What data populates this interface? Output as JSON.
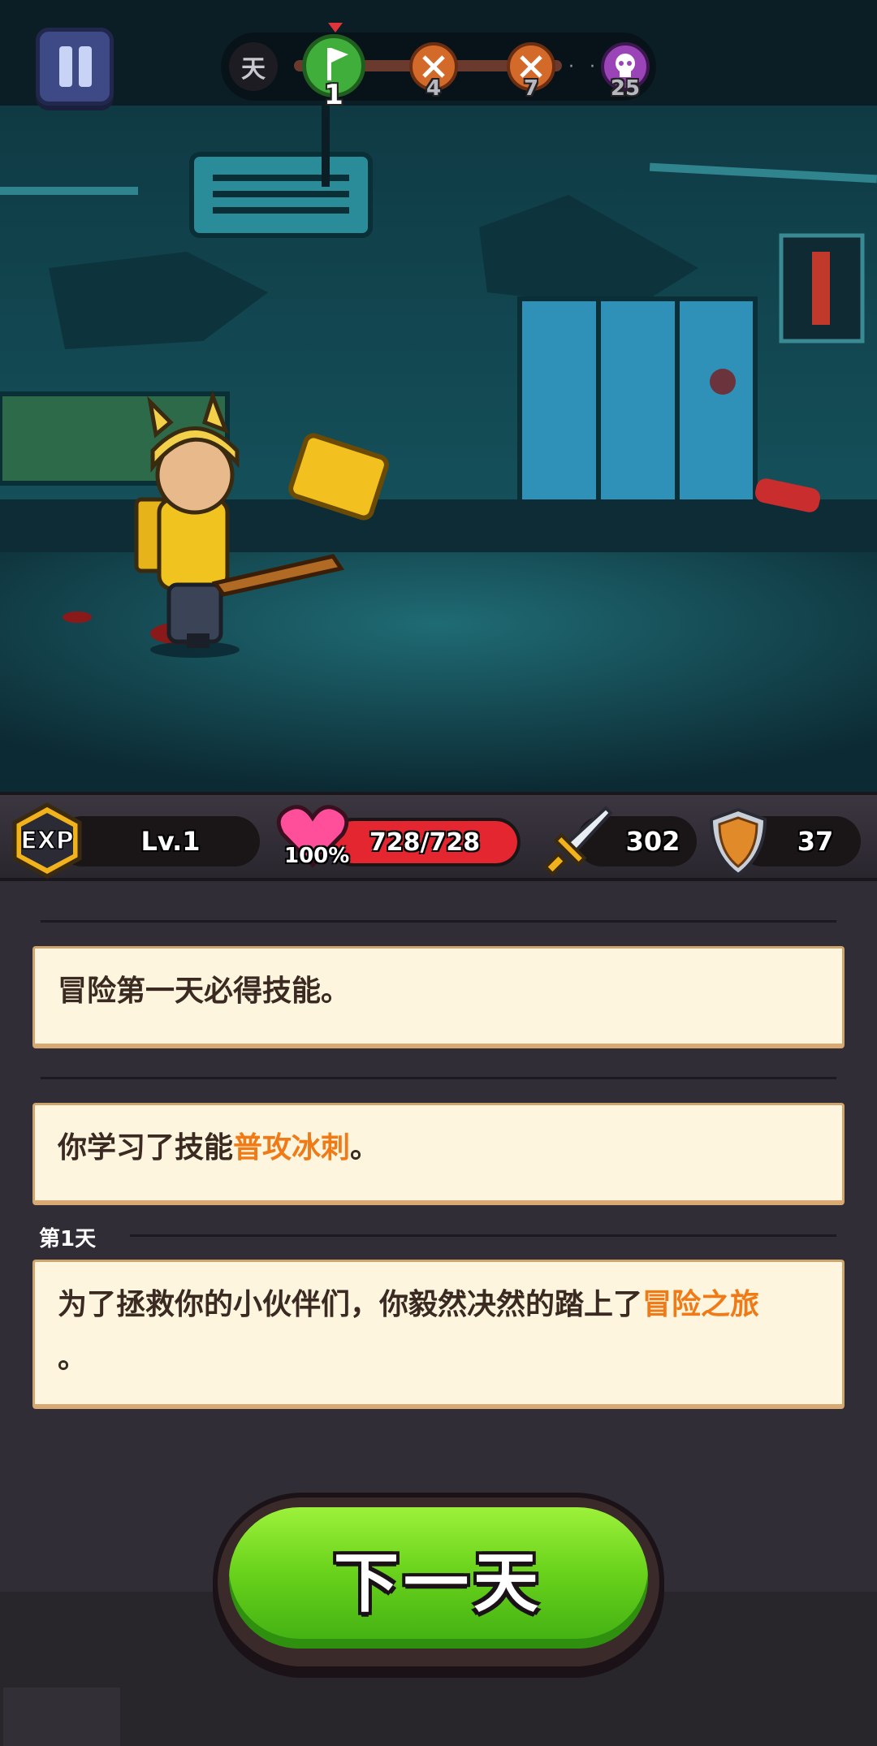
{
  "hud": {
    "day_tag": "天",
    "stages": [
      {
        "label": "1",
        "kind": "start"
      },
      {
        "label": "4",
        "kind": "fight"
      },
      {
        "label": "7",
        "kind": "fight"
      },
      {
        "label": "25",
        "kind": "boss"
      }
    ],
    "ellipsis": "· · ·"
  },
  "stats": {
    "exp_badge": "EXP",
    "level": "Lv.1",
    "hp_text": "728/728",
    "hp_percent": "100%",
    "hp_fill": 1.0,
    "attack": "302",
    "defense": "37"
  },
  "log": {
    "entry1": "冒险第一天必得技能。",
    "entry2_prefix": "你学习了技能",
    "entry2_skill": "普攻冰刺",
    "entry2_suffix": "。",
    "day_label": "第1天",
    "entry3_prefix": "为了拯救你的小伙伴们，你毅然决然的踏上了",
    "entry3_highlight": "冒险之旅",
    "entry3_suffix": "。"
  },
  "next_button": "下一天",
  "colors": {
    "highlight": "#f07a16",
    "hp_red": "#e3262f",
    "button_green": "#6ad31c"
  }
}
